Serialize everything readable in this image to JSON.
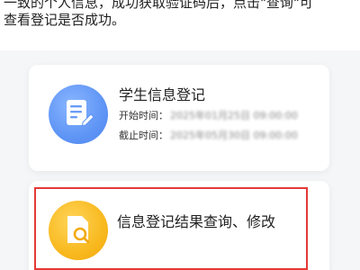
{
  "intro": {
    "line1": "一致的个人信息，成功获取验证码后，点击\"查询\"可",
    "line2": "查看登记是否成功。"
  },
  "cards": [
    {
      "title": "学生信息登记",
      "icon": "form-edit-icon",
      "start_label": "开始时间：",
      "start_value": "2025年01月25日 09:00:00",
      "end_label": "截止时间：",
      "end_value": "2025年05月30日 09:00:00"
    },
    {
      "title": "信息登记结果查询、修改",
      "icon": "document-search-icon"
    }
  ],
  "colors": {
    "blue_icon": "#5f95f5",
    "yellow_icon": "#f8b91f",
    "highlight_border": "#e53935"
  }
}
